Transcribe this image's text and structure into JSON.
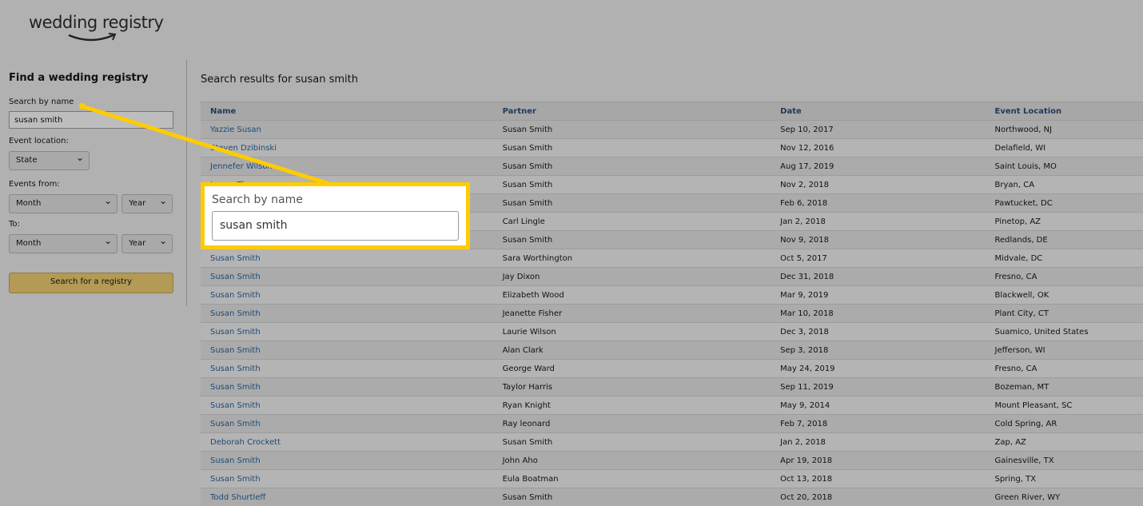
{
  "logo": "wedding registry",
  "sidebar": {
    "title": "Find a wedding registry",
    "search_label": "Search by name",
    "search_value": "susan smith",
    "location_label": "Event location:",
    "state": "State",
    "from_label": "Events from:",
    "to_label": "To:",
    "month": "Month",
    "year": "Year",
    "button": "Search for a registry"
  },
  "results": {
    "title": "Search results for susan smith",
    "headers": [
      "Name",
      "Partner",
      "Date",
      "Event Location"
    ],
    "rows": [
      [
        "Yazzie Susan",
        "Susan Smith",
        "Sep 10, 2017",
        "Northwood, NJ"
      ],
      [
        "Steven Dzibinski",
        "Susan Smith",
        "Nov 12, 2016",
        "Delafield, WI"
      ],
      [
        "Jennefer Wilson",
        "Susan Smith",
        "Aug 17, 2019",
        "Saint Louis, MO"
      ],
      [
        "James Thompson",
        "Susan Smith",
        "Nov 2, 2018",
        "Bryan, CA"
      ],
      [
        "",
        "Susan Smith",
        "Feb 6, 2018",
        "Pawtucket, DC"
      ],
      [
        "",
        "Carl Lingle",
        "Jan 2, 2018",
        "Pinetop, AZ"
      ],
      [
        "",
        "Susan Smith",
        "Nov 9, 2018",
        "Redlands, DE"
      ],
      [
        "Susan Smith",
        "Sara Worthington",
        "Oct 5, 2017",
        "Midvale, DC"
      ],
      [
        "Susan Smith",
        "Jay Dixon",
        "Dec 31, 2018",
        "Fresno, CA"
      ],
      [
        "Susan Smith",
        "Elizabeth Wood",
        "Mar 9, 2019",
        "Blackwell, OK"
      ],
      [
        "Susan Smith",
        "Jeanette Fisher",
        "Mar 10, 2018",
        "Plant City, CT"
      ],
      [
        "Susan Smith",
        "Laurie Wilson",
        "Dec 3, 2018",
        "Suamico, United States"
      ],
      [
        "Susan Smith",
        "Alan Clark",
        "Sep 3, 2018",
        "Jefferson, WI"
      ],
      [
        "Susan Smith",
        "George Ward",
        "May 24, 2019",
        "Fresno, CA"
      ],
      [
        "Susan Smith",
        "Taylor Harris",
        "Sep 11, 2019",
        "Bozeman, MT"
      ],
      [
        "Susan Smith",
        "Ryan Knight",
        "May 9, 2014",
        "Mount Pleasant, SC"
      ],
      [
        "Susan Smith",
        "Ray leonard",
        "Feb 7, 2018",
        "Cold Spring, AR"
      ],
      [
        "Deborah Crockett",
        "Susan Smith",
        "Jan 2, 2018",
        "Zap, AZ"
      ],
      [
        "Susan Smith",
        "John Aho",
        "Apr 19, 2018",
        "Gainesville, TX"
      ],
      [
        "Susan Smith",
        "Eula Boatman",
        "Oct 13, 2018",
        "Spring, TX"
      ],
      [
        "Todd Shurtleff",
        "Susan Smith",
        "Oct 20, 2018",
        "Green River, WY"
      ]
    ]
  },
  "callout": {
    "label": "Search by name",
    "value": "susan smith",
    "color": "#ffcc00"
  }
}
